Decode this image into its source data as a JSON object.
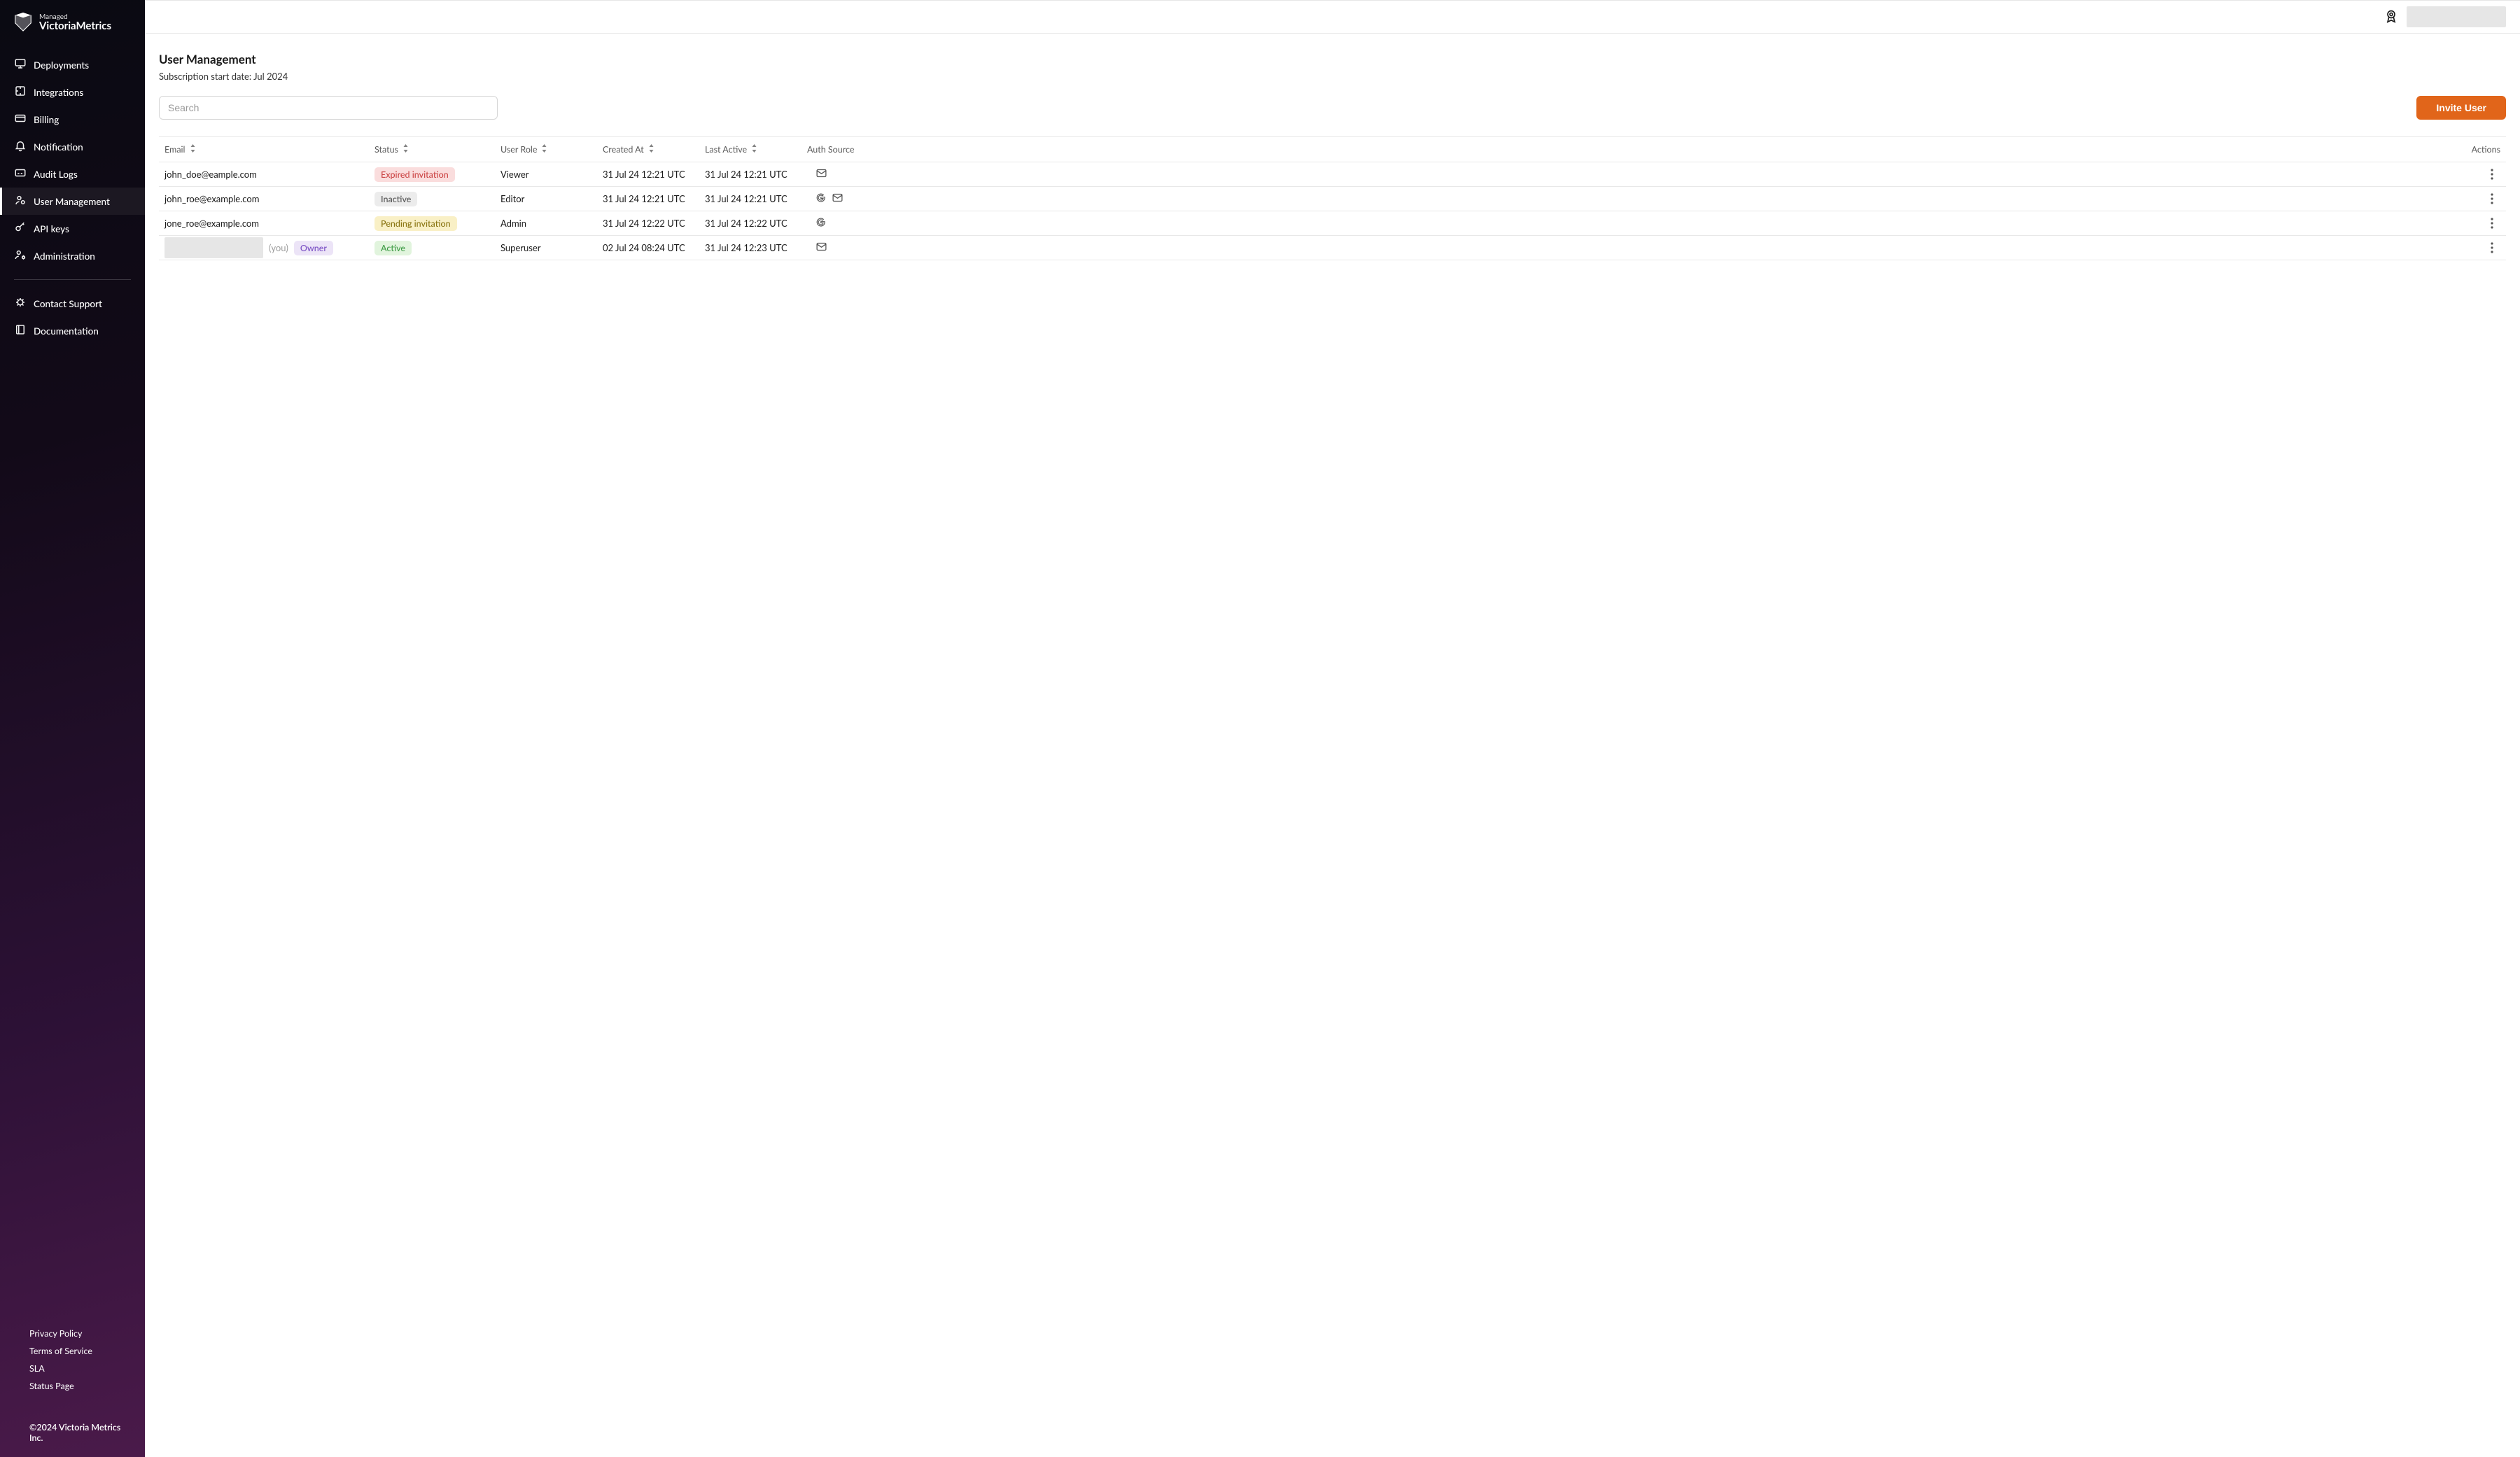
{
  "brand": {
    "line1": "Managed",
    "line2": "VictoriaMetrics"
  },
  "sidebar": {
    "items": [
      {
        "id": "deployments",
        "label": "Deployments",
        "icon": "monitor"
      },
      {
        "id": "integrations",
        "label": "Integrations",
        "icon": "puzzle"
      },
      {
        "id": "billing",
        "label": "Billing",
        "icon": "card"
      },
      {
        "id": "notification",
        "label": "Notification",
        "icon": "bell"
      },
      {
        "id": "audit-logs",
        "label": "Audit Logs",
        "icon": "cc"
      },
      {
        "id": "user-management",
        "label": "User Management",
        "icon": "user-gear",
        "active": true
      },
      {
        "id": "api-keys",
        "label": "API keys",
        "icon": "key"
      },
      {
        "id": "administration",
        "label": "Administration",
        "icon": "user-cog"
      }
    ],
    "support": [
      {
        "id": "contact-support",
        "label": "Contact Support",
        "icon": "bug"
      },
      {
        "id": "documentation",
        "label": "Documentation",
        "icon": "book"
      }
    ],
    "footer_links": [
      {
        "id": "privacy",
        "label": "Privacy Policy"
      },
      {
        "id": "tos",
        "label": "Terms of Service"
      },
      {
        "id": "sla",
        "label": "SLA"
      },
      {
        "id": "status",
        "label": "Status Page"
      }
    ],
    "copyright": "©2024 Victoria Metrics Inc."
  },
  "page": {
    "title": "User Management",
    "subtitle": "Subscription start date: Jul 2024",
    "search_placeholder": "Search",
    "invite_button": "Invite User"
  },
  "columns": {
    "email": "Email",
    "status": "Status",
    "user_role": "User Role",
    "created_at": "Created At",
    "last_active": "Last Active",
    "auth_source": "Auth Source",
    "actions": "Actions"
  },
  "status_labels": {
    "expired": "Expired invitation",
    "inactive": "Inactive",
    "pending": "Pending invitation",
    "active": "Active",
    "owner": "Owner"
  },
  "you_label": "(you)",
  "users": [
    {
      "email": "john_doe@eample.com",
      "status": "expired",
      "role": "Viewer",
      "created": "31 Jul 24 12:21 UTC",
      "last_active": "31 Jul 24 12:21 UTC",
      "auth": [
        "mail"
      ]
    },
    {
      "email": "john_roe@example.com",
      "status": "inactive",
      "role": "Editor",
      "created": "31 Jul 24 12:21 UTC",
      "last_active": "31 Jul 24 12:21 UTC",
      "auth": [
        "google",
        "mail"
      ]
    },
    {
      "email": "jone_roe@example.com",
      "status": "pending",
      "role": "Admin",
      "created": "31 Jul 24 12:22 UTC",
      "last_active": "31 Jul 24 12:22 UTC",
      "auth": [
        "google"
      ]
    },
    {
      "email_redacted": true,
      "is_you": true,
      "owner_badge": true,
      "status": "active",
      "role": "Superuser",
      "created": "02 Jul 24 08:24 UTC",
      "last_active": "31 Jul 24 12:23 UTC",
      "auth": [
        "mail"
      ]
    }
  ]
}
